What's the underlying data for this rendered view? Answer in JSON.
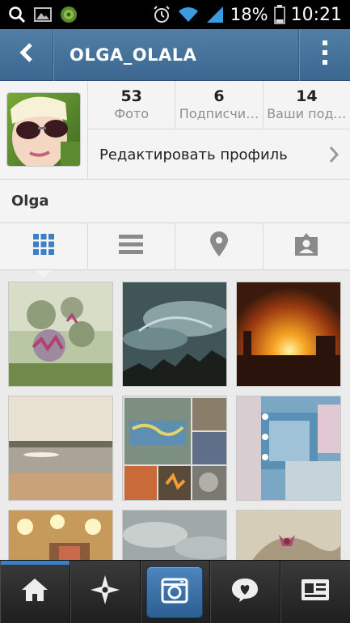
{
  "status_bar": {
    "battery_percent": "18%",
    "time": "10:21",
    "icons": [
      "search-icon",
      "image-icon",
      "app-icon",
      "alarm-icon",
      "wifi-icon",
      "signal-icon",
      "battery-icon"
    ]
  },
  "header": {
    "title": "OLGA_OLALA",
    "back_icon": "chevron-left-icon",
    "menu_icon": "more-vertical-icon",
    "bar_color": "#416f9b"
  },
  "profile": {
    "stats": [
      {
        "count": "53",
        "label": "Фото"
      },
      {
        "count": "6",
        "label": "Подписчи…"
      },
      {
        "count": "14",
        "label": "Ваши под…"
      }
    ],
    "edit_label": "Редактировать профиль",
    "name": "Olga"
  },
  "view_tabs": [
    {
      "icon": "grid-view-icon",
      "active": true
    },
    {
      "icon": "list-view-icon",
      "active": false
    },
    {
      "icon": "map-pin-icon",
      "active": false
    },
    {
      "icon": "tagged-photos-icon",
      "active": false
    }
  ],
  "photos": [
    "burdock-flowers",
    "cloudy-sky",
    "sunset",
    "lake-shore",
    "graffiti-collage",
    "makeup-mirror",
    "mirror-lights",
    "clouds",
    "hair-bow"
  ],
  "bottom_nav": [
    {
      "icon": "home-icon",
      "active": true
    },
    {
      "icon": "explore-icon",
      "active": false
    },
    {
      "icon": "camera-icon",
      "active": false
    },
    {
      "icon": "news-icon",
      "active": false
    },
    {
      "icon": "profile-card-icon",
      "active": false
    }
  ],
  "accent_color": "#3c7fc3"
}
